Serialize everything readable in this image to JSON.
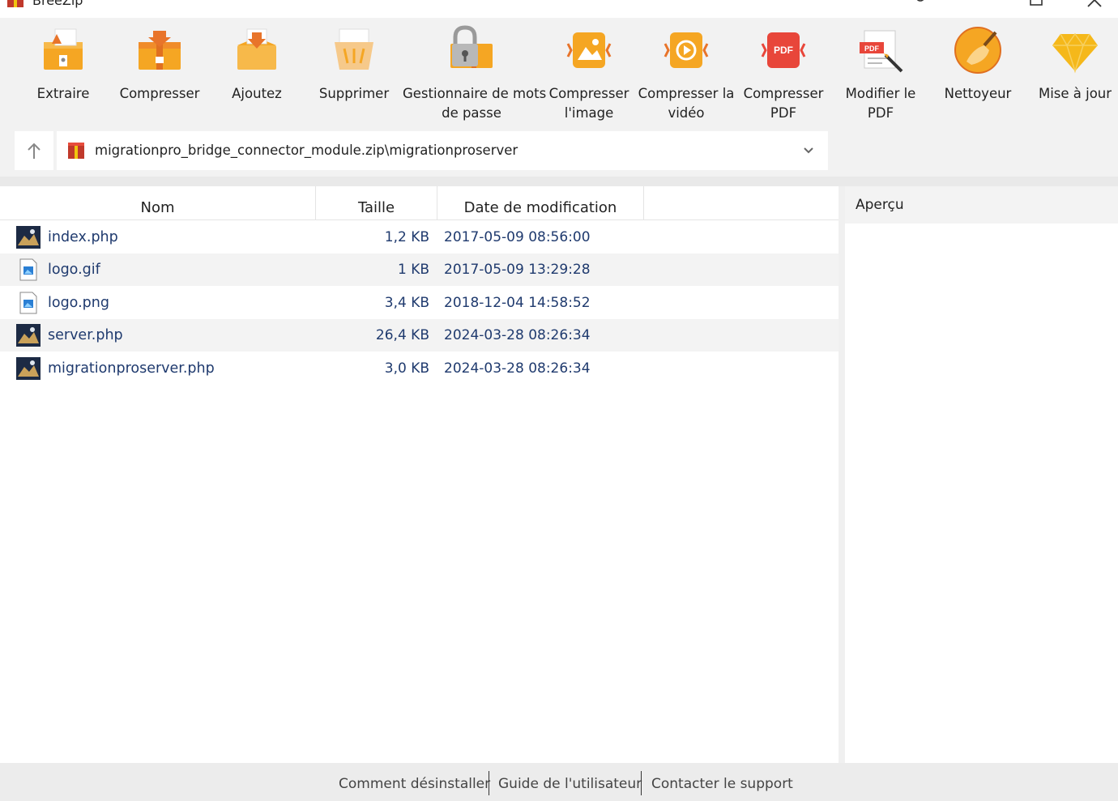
{
  "window": {
    "title": "BreeZip"
  },
  "toolbar": {
    "items": [
      {
        "label": "Extraire",
        "icon": "extract-icon"
      },
      {
        "label": "Compresser",
        "icon": "compress-icon"
      },
      {
        "label": "Ajoutez",
        "icon": "add-icon"
      },
      {
        "label": "Supprimer",
        "icon": "delete-icon"
      },
      {
        "label": "Gestionnaire de mots",
        "label2": "de passe",
        "icon": "password-manager-icon"
      },
      {
        "label": "Compresser",
        "label2": "l'image",
        "icon": "compress-image-icon"
      },
      {
        "label": "Compresser la",
        "label2": "vidéo",
        "icon": "compress-video-icon"
      },
      {
        "label": "Compresser",
        "label2": "PDF",
        "icon": "compress-pdf-icon",
        "badge": "PDF"
      },
      {
        "label": "Modifier le",
        "label2": "PDF",
        "icon": "edit-pdf-icon",
        "badge": "PDF"
      },
      {
        "label": "Nettoyeur",
        "icon": "cleaner-icon"
      },
      {
        "label": "Mise à jour",
        "icon": "upgrade-icon"
      }
    ]
  },
  "address": {
    "path": "migrationpro_bridge_connector_module.zip\\migrationproserver"
  },
  "columns": {
    "name": "Nom",
    "size": "Taille",
    "date": "Date de modification"
  },
  "files": [
    {
      "name": "index.php",
      "size": "1,2 KB",
      "date": "2017-05-09 08:56:00",
      "type": "php"
    },
    {
      "name": "logo.gif",
      "size": "1 KB",
      "date": "2017-05-09 13:29:28",
      "type": "image"
    },
    {
      "name": "logo.png",
      "size": "3,4 KB",
      "date": "2018-12-04 14:58:52",
      "type": "image"
    },
    {
      "name": "server.php",
      "size": "26,4 KB",
      "date": "2024-03-28 08:26:34",
      "type": "php"
    },
    {
      "name": "migrationproserver.php",
      "size": "3,0 KB",
      "date": "2024-03-28 08:26:34",
      "type": "php"
    }
  ],
  "preview": {
    "title": "Aperçu"
  },
  "footer": {
    "uninstall": "Comment désinstaller",
    "guide": "Guide de l'utilisateur",
    "support": "Contacter le support"
  },
  "colors": {
    "accent": "#f5a623",
    "link_text": "#1f3a6e",
    "toolbar_bg": "#f2f2f2",
    "pdf_red": "#e8463a"
  }
}
